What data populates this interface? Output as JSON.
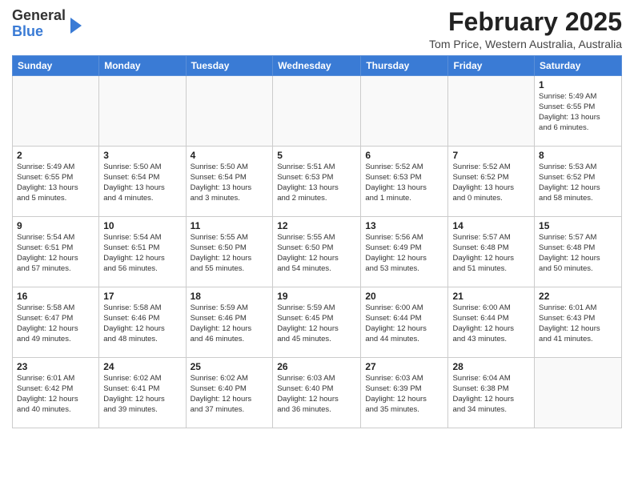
{
  "header": {
    "logo_general": "General",
    "logo_blue": "Blue",
    "month_title": "February 2025",
    "location": "Tom Price, Western Australia, Australia"
  },
  "weekdays": [
    "Sunday",
    "Monday",
    "Tuesday",
    "Wednesday",
    "Thursday",
    "Friday",
    "Saturday"
  ],
  "weeks": [
    [
      {
        "day": "",
        "info": ""
      },
      {
        "day": "",
        "info": ""
      },
      {
        "day": "",
        "info": ""
      },
      {
        "day": "",
        "info": ""
      },
      {
        "day": "",
        "info": ""
      },
      {
        "day": "",
        "info": ""
      },
      {
        "day": "1",
        "info": "Sunrise: 5:49 AM\nSunset: 6:55 PM\nDaylight: 13 hours\nand 6 minutes."
      }
    ],
    [
      {
        "day": "2",
        "info": "Sunrise: 5:49 AM\nSunset: 6:55 PM\nDaylight: 13 hours\nand 5 minutes."
      },
      {
        "day": "3",
        "info": "Sunrise: 5:50 AM\nSunset: 6:54 PM\nDaylight: 13 hours\nand 4 minutes."
      },
      {
        "day": "4",
        "info": "Sunrise: 5:50 AM\nSunset: 6:54 PM\nDaylight: 13 hours\nand 3 minutes."
      },
      {
        "day": "5",
        "info": "Sunrise: 5:51 AM\nSunset: 6:53 PM\nDaylight: 13 hours\nand 2 minutes."
      },
      {
        "day": "6",
        "info": "Sunrise: 5:52 AM\nSunset: 6:53 PM\nDaylight: 13 hours\nand 1 minute."
      },
      {
        "day": "7",
        "info": "Sunrise: 5:52 AM\nSunset: 6:52 PM\nDaylight: 13 hours\nand 0 minutes."
      },
      {
        "day": "8",
        "info": "Sunrise: 5:53 AM\nSunset: 6:52 PM\nDaylight: 12 hours\nand 58 minutes."
      }
    ],
    [
      {
        "day": "9",
        "info": "Sunrise: 5:54 AM\nSunset: 6:51 PM\nDaylight: 12 hours\nand 57 minutes."
      },
      {
        "day": "10",
        "info": "Sunrise: 5:54 AM\nSunset: 6:51 PM\nDaylight: 12 hours\nand 56 minutes."
      },
      {
        "day": "11",
        "info": "Sunrise: 5:55 AM\nSunset: 6:50 PM\nDaylight: 12 hours\nand 55 minutes."
      },
      {
        "day": "12",
        "info": "Sunrise: 5:55 AM\nSunset: 6:50 PM\nDaylight: 12 hours\nand 54 minutes."
      },
      {
        "day": "13",
        "info": "Sunrise: 5:56 AM\nSunset: 6:49 PM\nDaylight: 12 hours\nand 53 minutes."
      },
      {
        "day": "14",
        "info": "Sunrise: 5:57 AM\nSunset: 6:48 PM\nDaylight: 12 hours\nand 51 minutes."
      },
      {
        "day": "15",
        "info": "Sunrise: 5:57 AM\nSunset: 6:48 PM\nDaylight: 12 hours\nand 50 minutes."
      }
    ],
    [
      {
        "day": "16",
        "info": "Sunrise: 5:58 AM\nSunset: 6:47 PM\nDaylight: 12 hours\nand 49 minutes."
      },
      {
        "day": "17",
        "info": "Sunrise: 5:58 AM\nSunset: 6:46 PM\nDaylight: 12 hours\nand 48 minutes."
      },
      {
        "day": "18",
        "info": "Sunrise: 5:59 AM\nSunset: 6:46 PM\nDaylight: 12 hours\nand 46 minutes."
      },
      {
        "day": "19",
        "info": "Sunrise: 5:59 AM\nSunset: 6:45 PM\nDaylight: 12 hours\nand 45 minutes."
      },
      {
        "day": "20",
        "info": "Sunrise: 6:00 AM\nSunset: 6:44 PM\nDaylight: 12 hours\nand 44 minutes."
      },
      {
        "day": "21",
        "info": "Sunrise: 6:00 AM\nSunset: 6:44 PM\nDaylight: 12 hours\nand 43 minutes."
      },
      {
        "day": "22",
        "info": "Sunrise: 6:01 AM\nSunset: 6:43 PM\nDaylight: 12 hours\nand 41 minutes."
      }
    ],
    [
      {
        "day": "23",
        "info": "Sunrise: 6:01 AM\nSunset: 6:42 PM\nDaylight: 12 hours\nand 40 minutes."
      },
      {
        "day": "24",
        "info": "Sunrise: 6:02 AM\nSunset: 6:41 PM\nDaylight: 12 hours\nand 39 minutes."
      },
      {
        "day": "25",
        "info": "Sunrise: 6:02 AM\nSunset: 6:40 PM\nDaylight: 12 hours\nand 37 minutes."
      },
      {
        "day": "26",
        "info": "Sunrise: 6:03 AM\nSunset: 6:40 PM\nDaylight: 12 hours\nand 36 minutes."
      },
      {
        "day": "27",
        "info": "Sunrise: 6:03 AM\nSunset: 6:39 PM\nDaylight: 12 hours\nand 35 minutes."
      },
      {
        "day": "28",
        "info": "Sunrise: 6:04 AM\nSunset: 6:38 PM\nDaylight: 12 hours\nand 34 minutes."
      },
      {
        "day": "",
        "info": ""
      }
    ]
  ]
}
